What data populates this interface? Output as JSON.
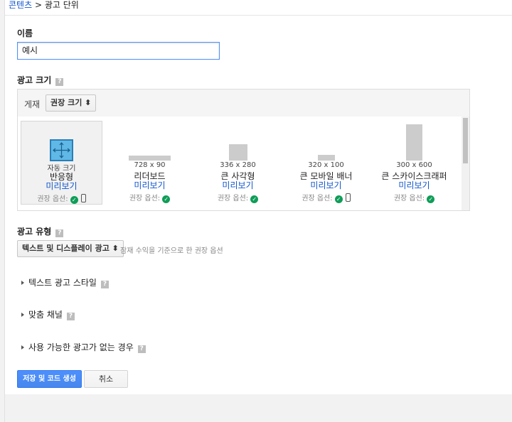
{
  "breadcrumb": {
    "parent": "콘텐츠",
    "separator": " > ",
    "current": "광고 단위"
  },
  "name_field": {
    "label": "이름",
    "value": "예시"
  },
  "ad_size": {
    "label": "광고 크기",
    "placement_label": "게재",
    "filter_value": "권장 크기 ⬍",
    "recommended_label": "권장 옵션:",
    "options": [
      {
        "dims": "자동 크기",
        "name": "반응형",
        "preview": "미리보기",
        "mobile": true,
        "selected": true
      },
      {
        "dims": "728 x 90",
        "name": "리더보드",
        "preview": "미리보기",
        "mobile": false,
        "selected": false
      },
      {
        "dims": "336 x 280",
        "name": "큰 사각형",
        "preview": "미리보기",
        "mobile": false,
        "selected": false
      },
      {
        "dims": "320 x 100",
        "name": "큰 모바일 배너",
        "preview": "미리보기",
        "mobile": true,
        "selected": false
      },
      {
        "dims": "300 x 600",
        "name": "큰 스카이스크래퍼",
        "preview": "미리보기",
        "mobile": false,
        "selected": false
      }
    ]
  },
  "ad_type": {
    "label": "광고 유형",
    "value": "텍스트 및 디스플레이 광고 ⬍",
    "hint": "잠재 수익을 기준으로 한 권장 옵션"
  },
  "sections": {
    "text_style": "텍스트 광고 스타일",
    "custom_channel": "맞춤 채널",
    "no_ads": "사용 가능한 광고가 없는 경우"
  },
  "buttons": {
    "save": "저장 및 코드 생성",
    "cancel": "취소"
  },
  "icons": {
    "help": "?",
    "check": "✓"
  },
  "colors": {
    "link": "#1155cc",
    "primary": "#4d90fe",
    "check": "#0f9d58"
  }
}
